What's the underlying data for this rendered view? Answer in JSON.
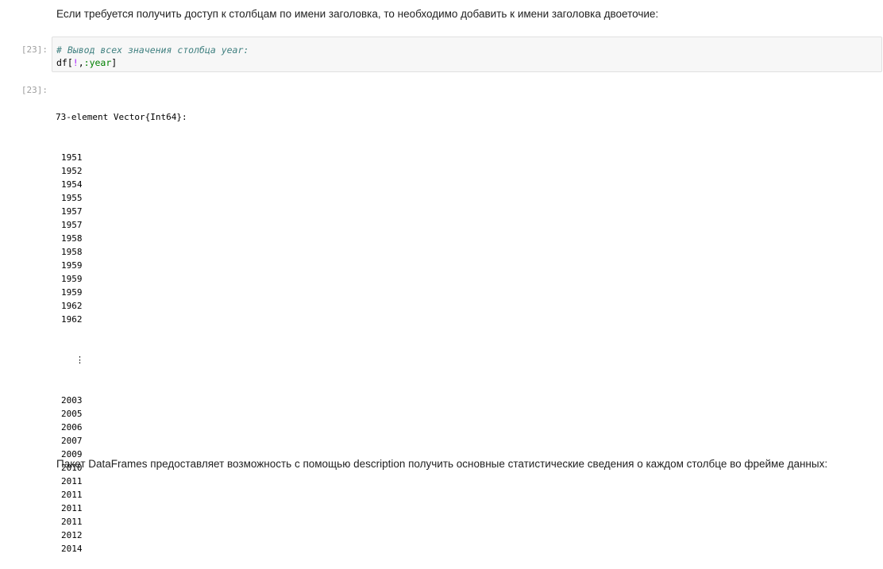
{
  "markdown": {
    "top": "Если требуется получить доступ к столбцам по имени заголовка, то необходимо добавить к имени заголовка двоеточие:",
    "bottom": "Пакет DataFrames предоставляет возможность с помощью description получить основные статистические сведения о каждом столбце во фрейме данных:"
  },
  "cell": {
    "in_prompt": "[23]:",
    "out_prompt": "[23]:",
    "code": {
      "comment": "# Вывод всех значения столбца year:",
      "line2_prefix": "df[",
      "line2_op": "!",
      "line2_comma": ",",
      "line2_symbol": ":year",
      "line2_suffix": "]"
    },
    "output": {
      "header": "73-element Vector{Int64}:",
      "head_values": [
        "1951",
        "1952",
        "1954",
        "1955",
        "1957",
        "1957",
        "1958",
        "1958",
        "1959",
        "1959",
        "1959",
        "1962",
        "1962"
      ],
      "ellipsis": "⋮",
      "tail_values": [
        "2003",
        "2005",
        "2006",
        "2007",
        "2009",
        "2010",
        "2011",
        "2011",
        "2011",
        "2011",
        "2012",
        "2014"
      ]
    }
  }
}
